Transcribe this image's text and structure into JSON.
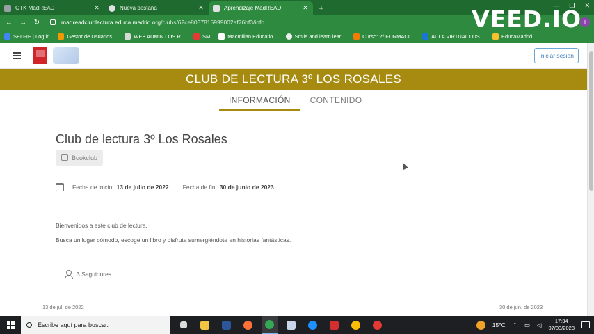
{
  "browser": {
    "tabs": [
      {
        "label": "OTK MadREAD",
        "active": false,
        "favicon_color": "#9aa0a6"
      },
      {
        "label": "Nueva pestaña",
        "active": false,
        "favicon_color": "#dfe1e5"
      },
      {
        "label": "Aprendizaje MadREAD",
        "active": true,
        "favicon_color": "#dfe1e5"
      }
    ],
    "url_host": "madreadclublectura.educa.madrid.org",
    "url_path": "/clubs/62ce8037815999002af76bf3/info",
    "profile_initial": "I",
    "bookmarks": [
      "SELFIE | Log in",
      "Gestor de Usuarios...",
      "WEB ADMIN LOS R...",
      "SM",
      "Macmillan Educatio...",
      "Smile and learn lear...",
      "Curso: 2º FORMACI...",
      "AULA VIRTUAL LOS...",
      "EducaMadrid"
    ]
  },
  "watermark": "VEED.IO",
  "site": {
    "login_label": "Iniciar sesión"
  },
  "banner": {
    "title": "CLUB DE LECTURA 3º LOS ROSALES"
  },
  "page_tabs": [
    {
      "label": "INFORMACIÓN",
      "active": true
    },
    {
      "label": "CONTENIDO",
      "active": false
    }
  ],
  "club": {
    "title": "Club de lectura 3º Los Rosales",
    "type_label": "Bookclub",
    "start_label": "Fecha de inicio:",
    "start_value": "13 de julio de 2022",
    "end_label": "Fecha de fin:",
    "end_value": "30 de junio de 2023",
    "description_1": "Bienvenidos a este club de lectura.",
    "description_2": "Busca un lugar cómodo, escoge un libro y disfruta sumergiéndote en historias fantásticas.",
    "followers": "3 Seguidores",
    "timeline_start": "13 de jul. de 2022",
    "timeline_end": "30 de jun. de 2023"
  },
  "taskbar": {
    "search_placeholder": "Escribe aquí para buscar.",
    "temperature": "15°C",
    "time": "17:34",
    "date": "07/03/2023",
    "apps": [
      {
        "name": "task-view-icon",
        "color": "#dcdcdc",
        "active": false
      },
      {
        "name": "file-explorer-icon",
        "color": "#f4c542",
        "active": false
      },
      {
        "name": "word-icon",
        "color": "#2b579a",
        "active": false
      },
      {
        "name": "firefox-icon",
        "color": "#ff7139",
        "active": false
      },
      {
        "name": "chrome-icon",
        "color": "#34a853",
        "active": true
      },
      {
        "name": "people-icon",
        "color": "#c9d6ea",
        "active": false
      },
      {
        "name": "edge-icon",
        "color": "#1e90ff",
        "active": false
      },
      {
        "name": "acrobat-icon",
        "color": "#d32f2f",
        "active": false
      },
      {
        "name": "chrome-icon-2",
        "color": "#fbbc05",
        "active": false
      },
      {
        "name": "recorder-icon",
        "color": "#e53935",
        "active": false
      }
    ]
  }
}
